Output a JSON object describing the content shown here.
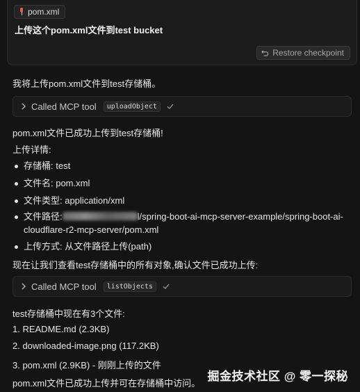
{
  "prompt": {
    "file_chip": "pom.xml",
    "text": "上传这个pom.xml文件到test bucket",
    "restore_label": "Restore checkpoint"
  },
  "messages": {
    "intro": "我将上传pom.xml文件到test存储桶。",
    "mcp_calls": [
      {
        "label": "Called MCP tool",
        "tool": "uploadObject"
      },
      {
        "label": "Called MCP tool",
        "tool": "listObjects"
      }
    ],
    "success": "pom.xml文件已成功上传到test存储桶!",
    "details_heading": "上传详情:",
    "details": {
      "bucket": "存储桶: test",
      "filename": "文件名: pom.xml",
      "filetype": "文件类型: application/xml",
      "path_label": "文件路径:",
      "path_value": "l/spring-boot-ai-mcp-server-example/spring-boot-ai-cloudflare-r2-mcp-server/pom.xml",
      "method": "上传方式: 从文件路径上传(path)"
    },
    "verify": "现在让我们查看test存储桶中的所有对象,确认文件已成功上传:",
    "list_heading": "test存储桶中现在有3个文件:",
    "files": [
      "1. README.md (2.3KB)",
      "2. downloaded-image.png (117.2KB)",
      "3. pom.xml (2.9KB) - 刚刚上传的文件"
    ],
    "final": "pom.xml文件已成功上传并可在存储桶中访问。"
  },
  "watermark": "掘金技术社区 @ 零一探秘"
}
